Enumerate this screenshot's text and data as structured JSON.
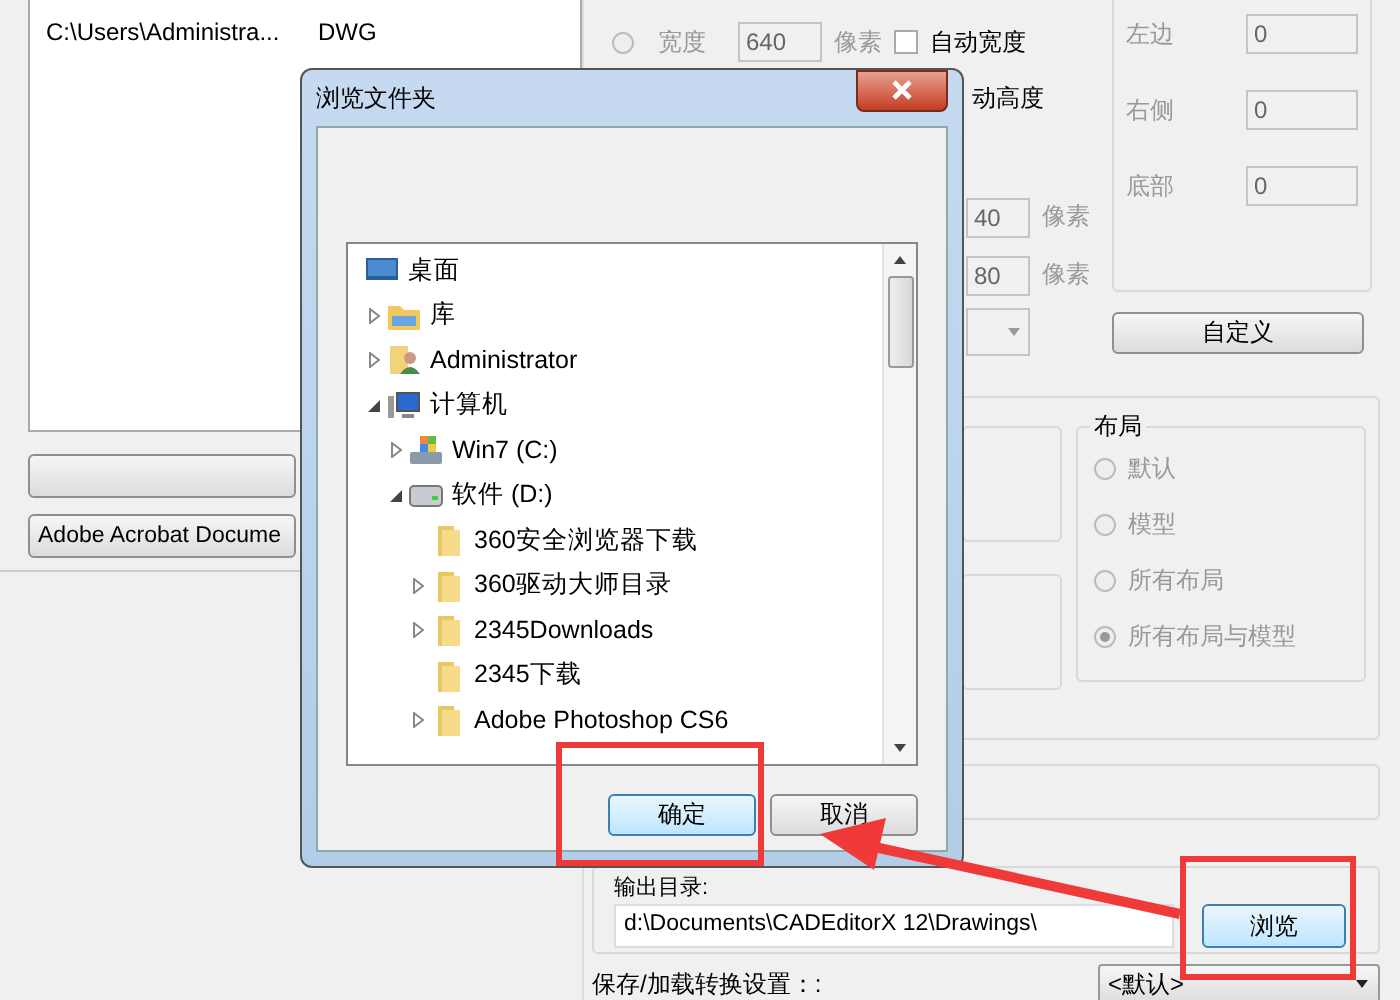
{
  "file_list": {
    "rows": [
      {
        "path": "C:\\Users\\Administra...",
        "type": "DWG"
      }
    ]
  },
  "format_button": {
    "label": "Adobe Acrobat Docume"
  },
  "size": {
    "selected": false,
    "width_label": "宽度",
    "width_value": "640",
    "width_unit": "像素",
    "auto_width": {
      "label": "自动宽度",
      "checked": false
    },
    "auto_height_label": "动高度",
    "rows": [
      {
        "value": "40",
        "unit": "像素"
      },
      {
        "value": "80",
        "unit": "像素"
      }
    ]
  },
  "margins": [
    {
      "label": "左边",
      "value": "0"
    },
    {
      "label": "右侧",
      "value": "0"
    },
    {
      "label": "底部",
      "value": "0"
    }
  ],
  "custom_button": {
    "label": "自定义"
  },
  "layout": {
    "title": "布局",
    "disabled": true,
    "options": [
      {
        "label": "默认",
        "selected": false
      },
      {
        "label": "模型",
        "selected": false
      },
      {
        "label": "所有布局",
        "selected": false
      },
      {
        "label": "所有布局与模型",
        "selected": true
      }
    ]
  },
  "output": {
    "label": "输出目录:",
    "value": "d:\\Documents\\CADEditorX 12\\Drawings\\",
    "browse_button": "浏览"
  },
  "settings": {
    "label": "保存/加载转换设置：:",
    "value": "<默认>"
  },
  "dialog": {
    "title": "浏览文件夹",
    "tree": [
      {
        "label": "桌面",
        "kind": "desktop",
        "children": [
          {
            "label": "库",
            "kind": "library",
            "expanded": false
          },
          {
            "label": "Administrator",
            "kind": "user",
            "expanded": false
          },
          {
            "label": "计算机",
            "kind": "computer",
            "expanded": true,
            "children": [
              {
                "label": "Win7 (C:)",
                "kind": "system-drive",
                "expanded": false
              },
              {
                "label": "软件 (D:)",
                "kind": "drive",
                "expanded": true,
                "children": [
                  {
                    "label": "360安全浏览器下载",
                    "kind": "folder"
                  },
                  {
                    "label": "360驱动大师目录",
                    "kind": "folder",
                    "expanded": false
                  },
                  {
                    "label": "2345Downloads",
                    "kind": "folder",
                    "expanded": false
                  },
                  {
                    "label": "2345下载",
                    "kind": "folder"
                  },
                  {
                    "label": "Adobe Photoshop CS6",
                    "kind": "folder",
                    "expanded": false
                  }
                ]
              }
            ]
          }
        ]
      }
    ],
    "buttons": [
      {
        "label": "确定",
        "focused": true
      },
      {
        "label": "取消",
        "focused": false
      }
    ]
  }
}
